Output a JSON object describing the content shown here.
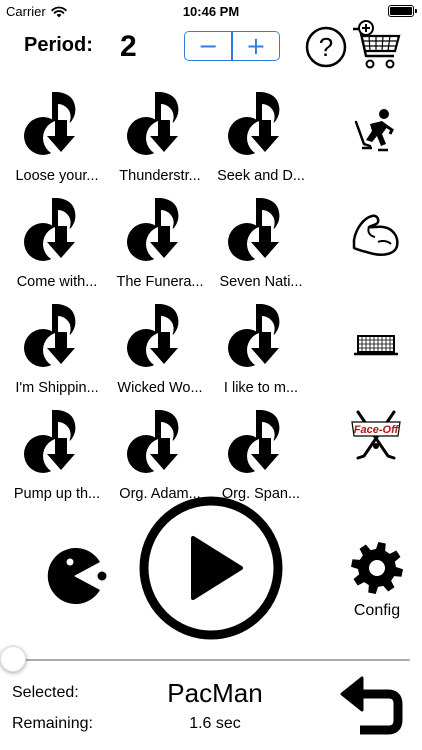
{
  "status_bar": {
    "carrier": "Carrier",
    "time": "10:46 PM"
  },
  "header": {
    "period_label": "Period:",
    "period_value": "2",
    "minus_label": "−",
    "plus_label": "+",
    "help_glyph": "?"
  },
  "songs": [
    {
      "label": "Loose your..."
    },
    {
      "label": "Thunderstr..."
    },
    {
      "label": "Seek and D..."
    },
    {
      "label": "Come with..."
    },
    {
      "label": "The Funera..."
    },
    {
      "label": "Seven Nati..."
    },
    {
      "label": "I'm Shippin..."
    },
    {
      "label": "Wicked Wo..."
    },
    {
      "label": "I like to m..."
    },
    {
      "label": "Pump up th..."
    },
    {
      "label": "Org. Adam..."
    },
    {
      "label": "Org. Span..."
    }
  ],
  "side_icons": [
    {
      "name": "hockey-player-icon"
    },
    {
      "name": "flexed-arm-icon"
    },
    {
      "name": "hockey-goal-icon"
    },
    {
      "name": "face-off-icon",
      "text": "Face-Off"
    }
  ],
  "controls": {
    "config_label": "Config"
  },
  "slider": {
    "value": 0
  },
  "footer": {
    "selected_label": "Selected:",
    "selected_value": "PacMan",
    "remaining_label": "Remaining:",
    "remaining_value": "1.6 sec"
  }
}
